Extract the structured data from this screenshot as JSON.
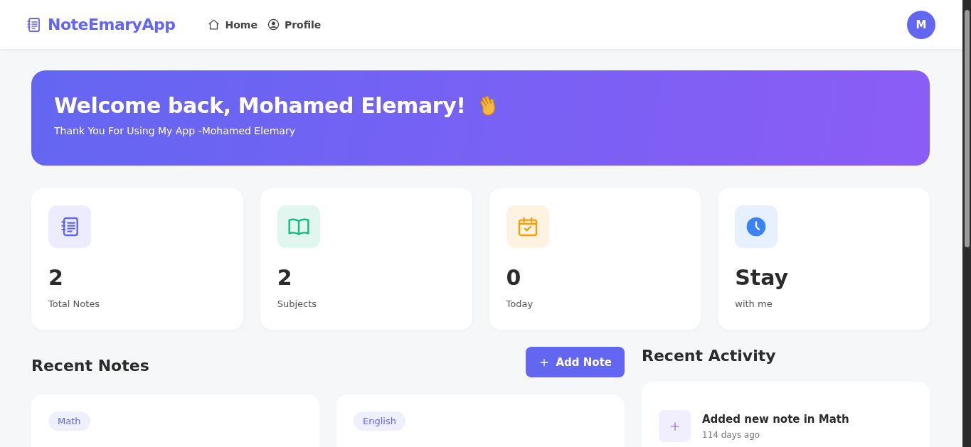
{
  "navbar": {
    "brand": "NoteEmaryApp",
    "links": [
      {
        "label": "Home",
        "kind": "home"
      },
      {
        "label": "Profile",
        "kind": "profile"
      }
    ],
    "avatar": "M"
  },
  "hero": {
    "title": "Welcome back, Mohamed Elemary!",
    "subtitle": "Thank You For Using My App -Mohamed Elemary"
  },
  "stats": [
    {
      "kind": "notes",
      "value": "2",
      "label": "Total Notes",
      "color": "#6366f1"
    },
    {
      "kind": "book",
      "value": "2",
      "label": "Subjects",
      "color": "#10b981"
    },
    {
      "kind": "calendar",
      "value": "0",
      "label": "Today",
      "color": "#f59e0b"
    },
    {
      "kind": "clock",
      "value": "Stay",
      "label": "with me",
      "color": "#3b82f6"
    }
  ],
  "recent_notes": {
    "title": "Recent Notes",
    "add_button": "Add Note",
    "notes": [
      {
        "subject": "Math"
      },
      {
        "subject": "English"
      }
    ]
  },
  "recent_activity": {
    "title": "Recent Activity",
    "items": [
      {
        "text": "Added new note in Math",
        "time": "114 days ago"
      }
    ]
  }
}
